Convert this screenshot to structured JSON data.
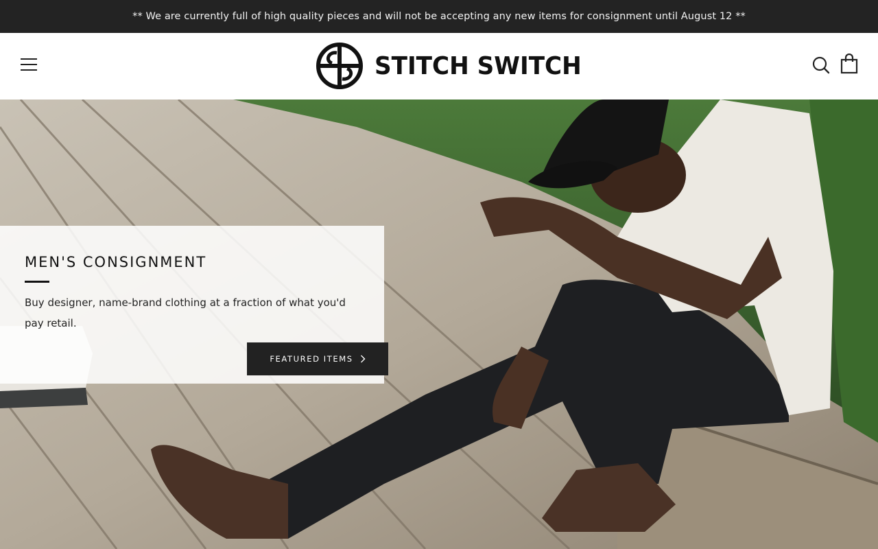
{
  "announcement": {
    "text": "** We are currently full of high quality pieces and will not be accepting any new items for consignment until August 12 **"
  },
  "header": {
    "brand_name": "STITCH SWITCH",
    "icons": {
      "menu": "hamburger-menu-icon",
      "search": "search-icon",
      "cart": "shopping-bag-icon"
    }
  },
  "hero": {
    "title": "MEN'S CONSIGNMENT",
    "description": "Buy designer, name-brand clothing at a fraction of what you'd pay retail.",
    "button_label": "FEATURED ITEMS"
  },
  "colors": {
    "announcement_bg": "#232323",
    "button_bg": "#222222",
    "text_dark": "#111111"
  }
}
